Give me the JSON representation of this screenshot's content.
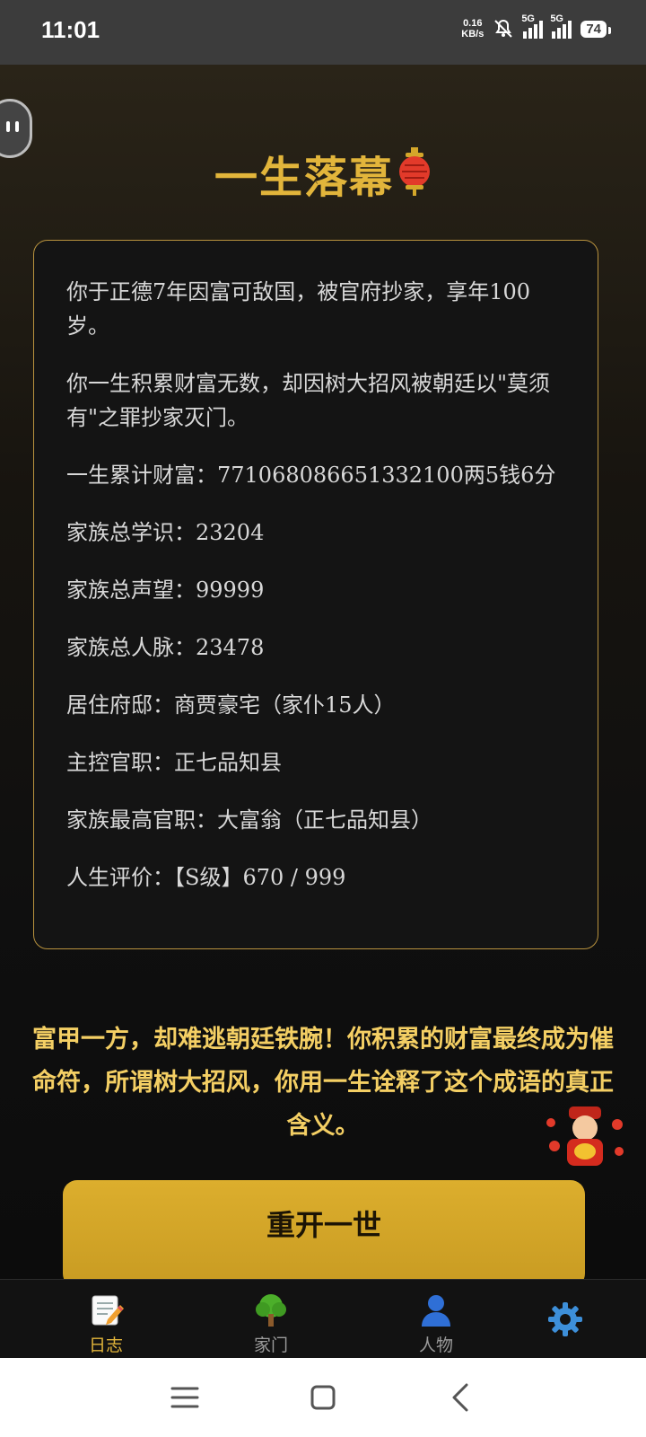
{
  "status_bar": {
    "time": "11:01",
    "net_speed_value": "0.16",
    "net_speed_unit": "KB/s",
    "signal1_label": "5G",
    "signal2_label": "5G",
    "battery": "74",
    "icons": [
      "mute-bell-icon",
      "signal-icon",
      "signal-icon",
      "battery-icon"
    ]
  },
  "page": {
    "title": "一生落幕",
    "title_icon": "lantern-icon"
  },
  "summary": {
    "lines": [
      "你于正德7年因富可敌国，被官府抄家，享年100岁。",
      "你一生积累财富无数，却因树大招风被朝廷以\"莫须有\"之罪抄家灭门。",
      "一生累计财富：77106808665133210​0两5钱6分",
      "家族总学识：23204",
      "家族总声望：99999",
      "家族总人脉：23478",
      "居住府邸：商贾豪宅（家仆15人）",
      "主控官职：正七品知县",
      "家族最高官职：大富翁（正七品知县）",
      "人生评价：【S级】670 / 999"
    ]
  },
  "verdict": "富甲一方，却难逃朝廷铁腕！你积累的财富最终成为催命符，所谓树大招风，你用一生诠释了这个成语的真正含义。",
  "restart_button": "重开一世",
  "tabs": [
    {
      "label": "日志",
      "icon": "memo-icon",
      "active": true
    },
    {
      "label": "家门",
      "icon": "tree-icon",
      "active": false
    },
    {
      "label": "人物",
      "icon": "person-icon",
      "active": false
    },
    {
      "label": "",
      "icon": "gear-icon",
      "active": false
    }
  ],
  "colors": {
    "accent_gold": "#e2b53b",
    "button_gold": "#d4a72a",
    "card_border": "#b8923e",
    "verdict_text": "#f4cf64"
  }
}
